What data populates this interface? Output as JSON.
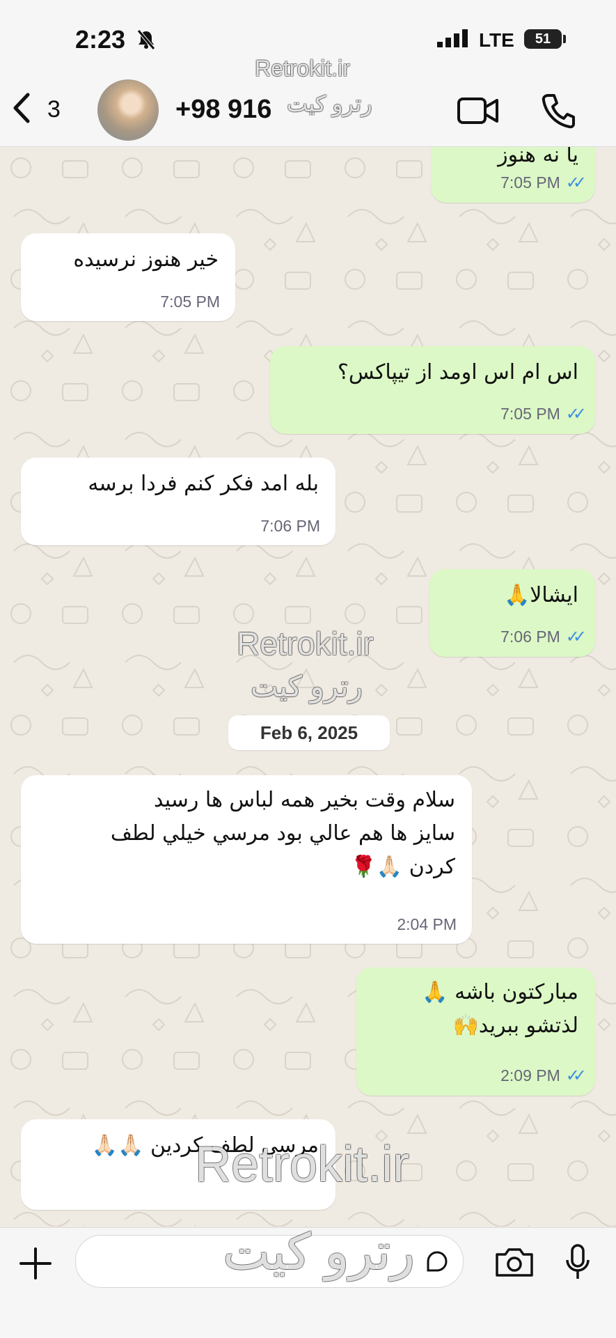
{
  "status_bar": {
    "time": "2:23",
    "network": "LTE",
    "battery": "51"
  },
  "header": {
    "back_count": "3",
    "contact_name": "+98 916"
  },
  "messages": [
    {
      "text": "يا نه هنوز",
      "time": "7:05 PM"
    },
    {
      "text": "خیر هنوز نرسیده",
      "time": "7:05 PM"
    },
    {
      "text": "اس ام اس اومد از تیپاکس؟",
      "time": "7:05 PM"
    },
    {
      "text": "بله امد فکر کنم فردا برسه",
      "time": "7:06 PM"
    },
    {
      "text": "ایشالا🙏",
      "time": "7:06 PM"
    },
    {
      "lines": [
        "سلام وقت بخیر همه لباس ها رسید",
        "سایز ها هم عالي بود مرسي خیلي لطف",
        "کردن 🙏🏻🌹"
      ],
      "time": "2:04 PM"
    },
    {
      "lines": [
        "مبارکتون باشه 🙏",
        "لذتشو ببرید🙌"
      ],
      "time": "2:09 PM"
    },
    {
      "text": "مرسي لطف کردین 🙏🏻🙏🏻"
    }
  ],
  "date_separator": "Feb 6, 2025",
  "watermark": {
    "latin": "Retrokit.ir",
    "persian": "رترو کیت"
  },
  "colors": {
    "outgoing": "#dcf8c6",
    "incoming": "#ffffff",
    "background": "#efeae2",
    "read_ticks": "#3b8fe0"
  }
}
